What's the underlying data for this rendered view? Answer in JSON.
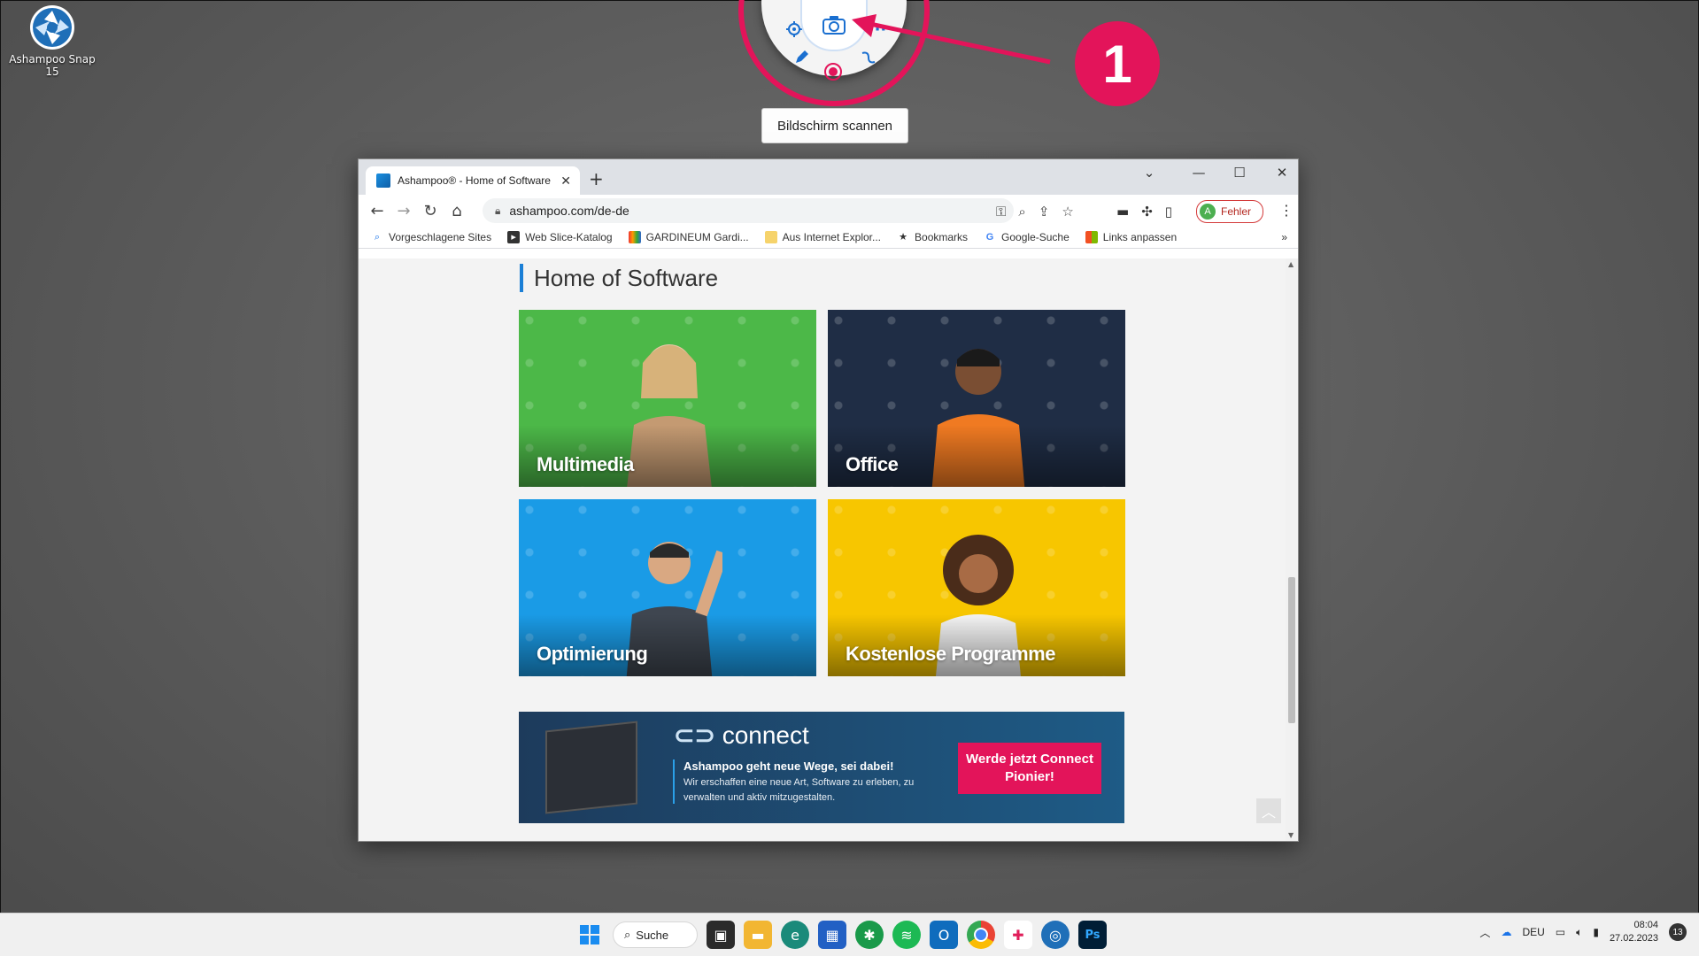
{
  "desktop": {
    "icon_label": "Ashampoo Snap 15"
  },
  "snap_widget": {
    "tooltip": "Bildschirm scannen",
    "badge_number": "1",
    "accent": "#e3145a"
  },
  "browser": {
    "tab_title": "Ashampoo® - Home of Software",
    "url": "ashampoo.com/de-de",
    "profile_initial": "A",
    "profile_label": "Fehler",
    "bookmarks": [
      "Vorgeschlagene Sites",
      "Web Slice-Katalog",
      "GARDINEUM Gardi...",
      "Aus Internet Explor...",
      "Bookmarks",
      "Google-Suche",
      "Links anpassen"
    ]
  },
  "page": {
    "heading": "Home of Software",
    "tiles": [
      {
        "label": "Multimedia",
        "color": "#4cb848"
      },
      {
        "label": "Office",
        "color": "#1f2d45"
      },
      {
        "label": "Optimierung",
        "color": "#1a9be6"
      },
      {
        "label": "Kostenlose Programme",
        "color": "#f7c600"
      }
    ],
    "banner": {
      "logo": "connect",
      "headline": "Ashampoo geht neue Wege, sei dabei!",
      "text": "Wir erschaffen eine neue Art, Software zu erleben, zu verwalten und aktiv mitzugestalten.",
      "cta": "Werde jetzt Connect Pionier!"
    }
  },
  "taskbar": {
    "search_label": "Suche",
    "language": "DEU",
    "time": "08:04",
    "date": "27.02.2023",
    "notification_count": "13"
  }
}
